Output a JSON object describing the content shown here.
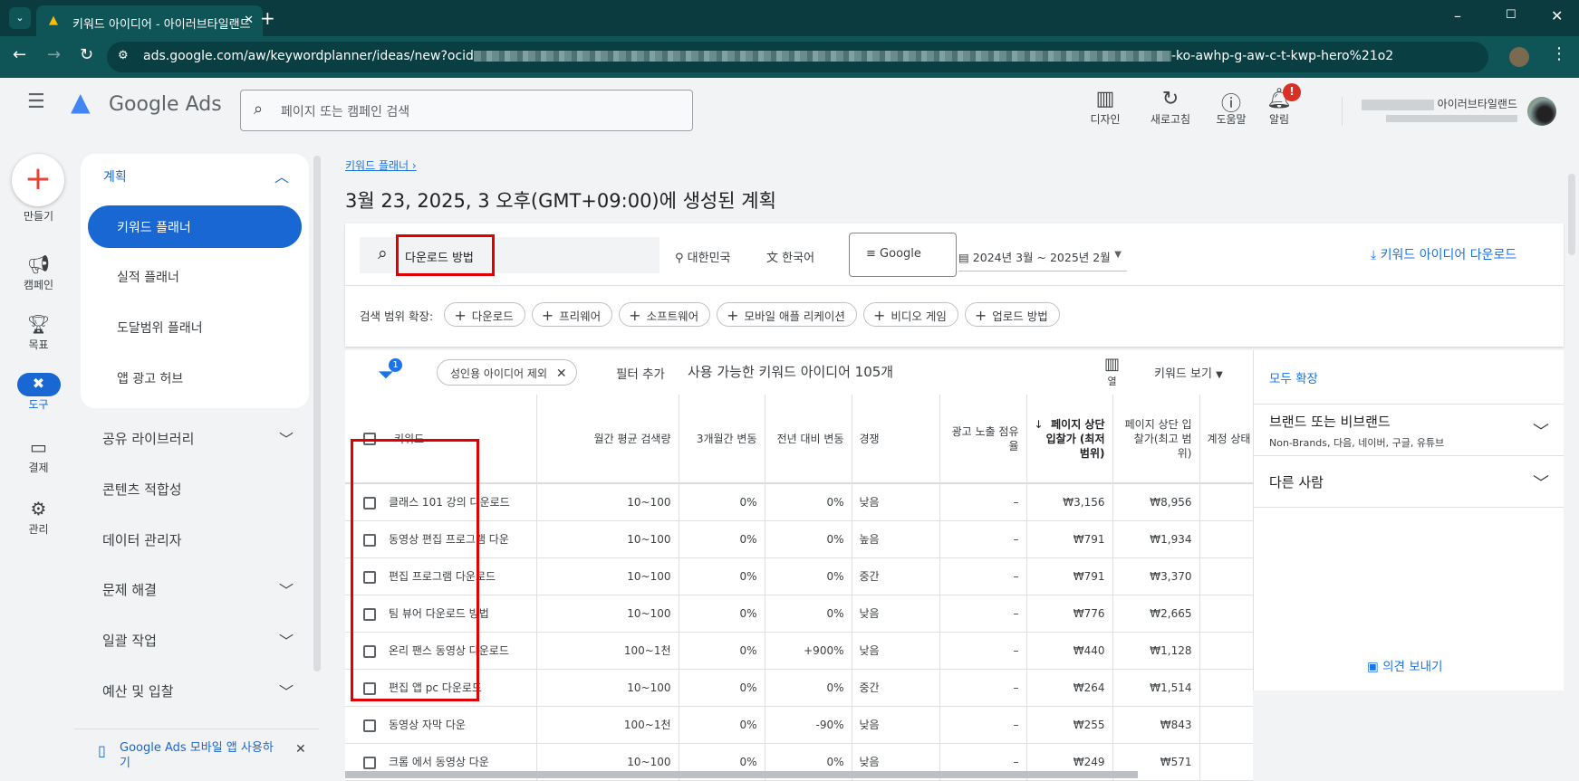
{
  "browser": {
    "tab_title": "키워드 아이디어 - 아이러브타일랜드",
    "url": "ads.google.com/aw/keywordplanner/ideas/new?ocid",
    "url_tail": "-ko-awhp-g-aw-c-t-kwp-hero%21o2"
  },
  "header": {
    "logo": "Google Ads",
    "search_placeholder": "페이지 또는 캠페인 검색",
    "icons": [
      {
        "icon": "design-icon",
        "label": "디자인"
      },
      {
        "icon": "refresh-icon",
        "label": "새로고침"
      },
      {
        "icon": "help-icon",
        "label": "도움말"
      },
      {
        "icon": "bell-icon",
        "label": "알림",
        "badge": "!"
      }
    ],
    "account_name": "아이러브타일랜드"
  },
  "rail": [
    {
      "icon": "create-icon",
      "label": "만들기"
    },
    {
      "icon": "campaign-icon",
      "label": "캠페인"
    },
    {
      "icon": "goal-icon",
      "label": "목표"
    },
    {
      "icon": "tools-icon",
      "label": "도구"
    },
    {
      "icon": "billing-icon",
      "label": "결제"
    },
    {
      "icon": "admin-icon",
      "label": "관리"
    }
  ],
  "nav": {
    "section": "계획",
    "items": [
      "키워드 플래너",
      "실적 플래너",
      "도달범위 플래너",
      "앱 광고 허브"
    ],
    "groups": [
      "공유 라이브러리",
      "콘텐츠 적합성",
      "데이터 관리자",
      "문제 해결",
      "일괄 작업",
      "예산 및 입찰"
    ],
    "mobile_app": "Google Ads 모바일 앱 사용하기"
  },
  "main": {
    "breadcrumb": "키워드 플래너",
    "title": "3월 23, 2025, 3 오후(GMT+09:00)에 생성된 계획",
    "query": "다운로드 방법",
    "location": "대한민국",
    "language": "한국어",
    "network": "Google",
    "date_range": "2024년 3월 ~ 2025년 2월",
    "download": "키워드 아이디어 다운로드",
    "broaden_label": "검색 범위 확장:",
    "broaden": [
      "다운로드",
      "프리웨어",
      "소프트웨어",
      "모바일 애플 리케이션",
      "비디오 게임",
      "업로드 방법"
    ],
    "filter_count": "1",
    "filter_chip": "성인용 아이디어 제외",
    "add_filter": "필터 추가",
    "available": "사용 가능한 키워드 아이디어 105개",
    "columns_label": "열",
    "view": "키워드 보기",
    "columns": [
      "키워드",
      "월간 평균 검색량",
      "3개월간 변동",
      "전년 대비 변동",
      "경쟁",
      "광고 노출 점유율",
      "페이지 상단 입찰가 (최저 범위)",
      "페이지 상단 입찰가(최고 범위)",
      "계정 상태"
    ],
    "rows": [
      [
        "클래스 101 강의 다운로드",
        "10~100",
        "0%",
        "0%",
        "낮음",
        "–",
        "₩3,156",
        "₩8,956"
      ],
      [
        "동영상 편집 프로그램 다운",
        "10~100",
        "0%",
        "0%",
        "높음",
        "–",
        "₩791",
        "₩1,934"
      ],
      [
        "편집 프로그램 다운로드",
        "10~100",
        "0%",
        "0%",
        "중간",
        "–",
        "₩791",
        "₩3,370"
      ],
      [
        "팀 뷰어 다운로드 방법",
        "10~100",
        "0%",
        "0%",
        "낮음",
        "–",
        "₩776",
        "₩2,665"
      ],
      [
        "온리 팬스 동영상 다운로드",
        "100~1천",
        "0%",
        "+900%",
        "낮음",
        "–",
        "₩440",
        "₩1,128"
      ],
      [
        "편집 앱 pc 다운로드",
        "10~100",
        "0%",
        "0%",
        "중간",
        "–",
        "₩264",
        "₩1,514"
      ],
      [
        "동영상 자막 다운",
        "100~1천",
        "0%",
        "-90%",
        "낮음",
        "–",
        "₩255",
        "₩843"
      ],
      [
        "크롬 에서 동영상 다운",
        "10~100",
        "0%",
        "0%",
        "낮음",
        "–",
        "₩249",
        "₩571"
      ]
    ]
  },
  "panel": {
    "expand_all": "모두 확장",
    "brand_title": "브랜드 또는 비브랜드",
    "brand_sub": "Non-Brands, 다음, 네이버, 구글, 유튜브",
    "others": "다른 사람",
    "feedback": "의견 보내기"
  },
  "colors": {
    "accent": "#1a73e8",
    "selected_nav": "#1967d2",
    "highlight": "#e00000"
  }
}
